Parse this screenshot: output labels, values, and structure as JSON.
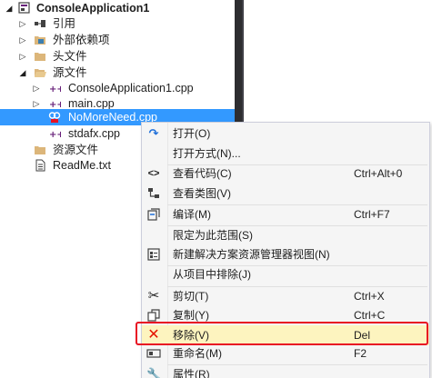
{
  "tree": {
    "project": "ConsoleApplication1",
    "references": "引用",
    "external_deps": "外部依赖项",
    "header_files": "头文件",
    "source_files": "源文件",
    "source_items": [
      "ConsoleApplication1.cpp",
      "main.cpp",
      "NoMoreNeed.cpp",
      "stdafx.cpp"
    ],
    "resource_files": "资源文件",
    "readme": "ReadMe.txt"
  },
  "context_menu": {
    "items": [
      {
        "label": "打开(O)",
        "shortcut": "",
        "icon": "open-arrow-icon"
      },
      {
        "label": "打开方式(N)...",
        "shortcut": "",
        "icon": ""
      },
      {
        "label": "查看代码(C)",
        "shortcut": "Ctrl+Alt+0",
        "icon": "code-brackets-icon"
      },
      {
        "label": "查看类图(V)",
        "shortcut": "",
        "icon": "class-diagram-icon"
      },
      {
        "label": "编译(M)",
        "shortcut": "Ctrl+F7",
        "icon": "compile-icon"
      },
      {
        "label": "限定为此范围(S)",
        "shortcut": "",
        "icon": ""
      },
      {
        "label": "新建解决方案资源管理器视图(N)",
        "shortcut": "",
        "icon": "new-view-icon"
      },
      {
        "label": "从项目中排除(J)",
        "shortcut": "",
        "icon": ""
      },
      {
        "label": "剪切(T)",
        "shortcut": "Ctrl+X",
        "icon": "scissors-icon"
      },
      {
        "label": "复制(Y)",
        "shortcut": "Ctrl+C",
        "icon": "copy-icon"
      },
      {
        "label": "移除(V)",
        "shortcut": "Del",
        "icon": "remove-x-icon"
      },
      {
        "label": "重命名(M)",
        "shortcut": "F2",
        "icon": "rename-icon"
      },
      {
        "label": "属性(R)",
        "shortcut": "",
        "icon": "wrench-icon"
      }
    ]
  },
  "colors": {
    "selection": "#3399ff",
    "highlight_box": "#e81123",
    "cpp_icon": "#68217a",
    "folder": "#dcb67a"
  }
}
